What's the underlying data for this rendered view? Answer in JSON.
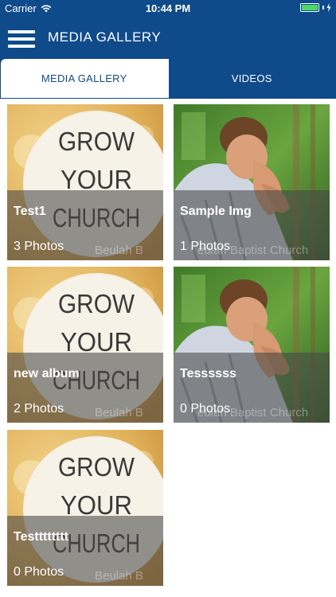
{
  "status_bar": {
    "carrier": "Carrier",
    "time": "10:44 PM",
    "wifi_icon": "wifi-icon",
    "battery_icon": "battery-icon",
    "charging_icon": "bolt-icon"
  },
  "nav": {
    "title": "MEDIA GALLERY",
    "menu_icon": "hamburger-menu-icon"
  },
  "tabs": [
    {
      "label": "MEDIA GALLERY",
      "active": true
    },
    {
      "label": "VIDEOS",
      "active": false
    }
  ],
  "colors": {
    "primary": "#0f4a8a",
    "tab_active_bg": "#ffffff",
    "overlay": "rgba(70,70,70,0.58)",
    "battery": "#4cd964"
  },
  "albums": [
    {
      "title": "Test1",
      "count": "3 Photos",
      "thumbnail": "grow-your-church-image",
      "watermark": "Beulah B"
    },
    {
      "title": "Sample Img",
      "count": "1 Photos",
      "thumbnail": "praying-man-image",
      "watermark": "eulah Baptist Church"
    },
    {
      "title": "new album",
      "count": "2 Photos",
      "thumbnail": "grow-your-church-image",
      "watermark": "Beulah B"
    },
    {
      "title": "Tessssss",
      "count": "0 Photos",
      "thumbnail": "praying-man-image",
      "watermark": "eulah Baptist Church"
    },
    {
      "title": "Testttttttt",
      "count": "0 Photos",
      "thumbnail": "grow-your-church-image",
      "watermark": "Beulah B"
    }
  ],
  "thumbnail_text": {
    "line1": "GROW",
    "line2": "YOUR",
    "line3": "CHURCH"
  }
}
